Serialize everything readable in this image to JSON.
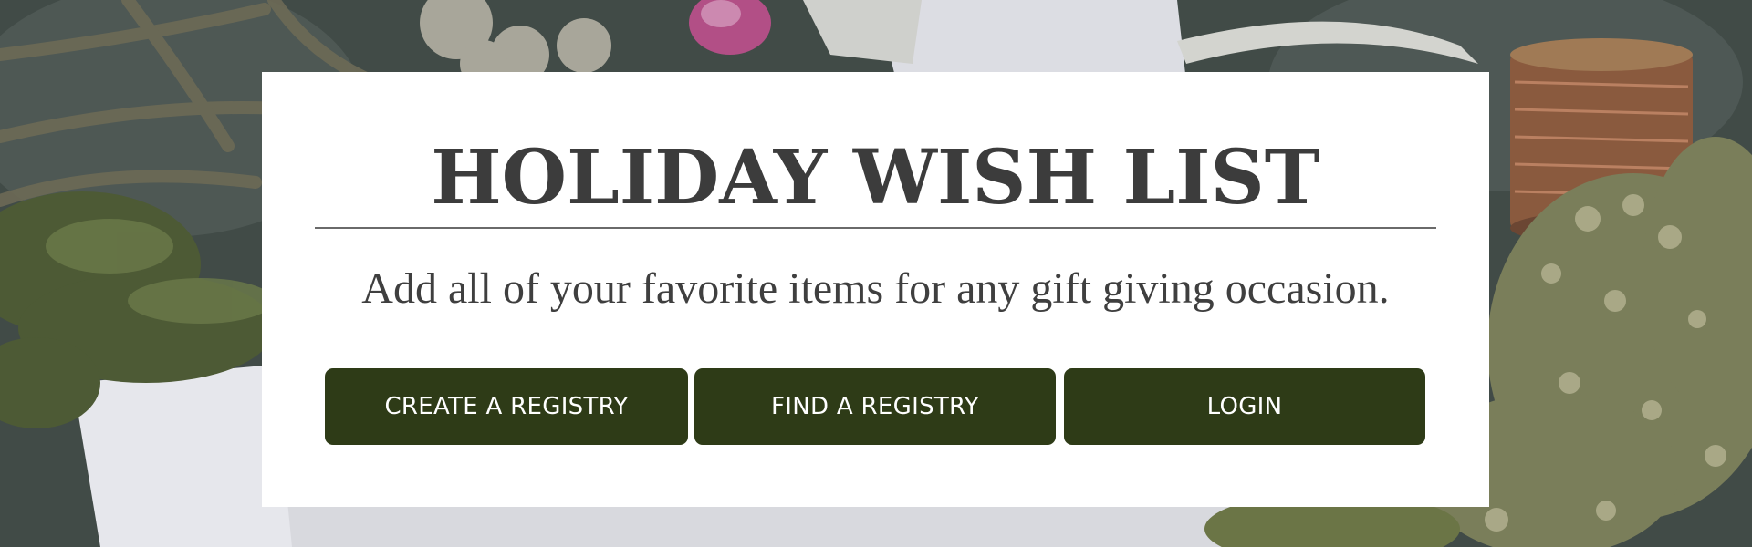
{
  "hero": {
    "title": "HOLIDAY WISH LIST",
    "subtitle": "Add all of your favorite items for any gift giving occasion."
  },
  "actions": {
    "create_label": "CREATE A REGISTRY",
    "find_label": "FIND A REGISTRY",
    "login_label": "LOGIN"
  },
  "colors": {
    "button_bg": "#2e3b17",
    "button_text": "#ffffff",
    "title_text": "#3c3c3c",
    "card_bg": "#ffffff"
  },
  "background_image": {
    "icon": "holiday-crafting-photo"
  }
}
